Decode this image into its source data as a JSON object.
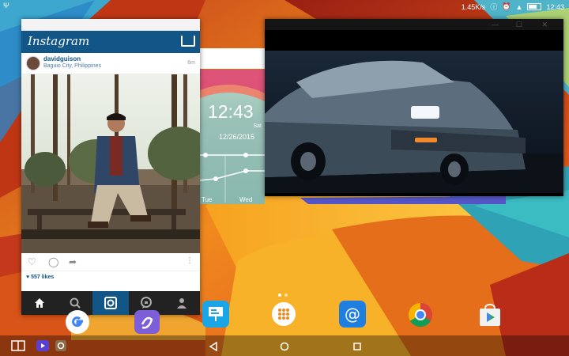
{
  "status_bar": {
    "network_speed": "1.45K/s",
    "clock": "12:43",
    "left_icon": "usb-icon"
  },
  "instagram": {
    "logo": "Instagram",
    "post": {
      "username": "davidguison",
      "location": "Baguio City, Philippines",
      "time": "6m",
      "likes": "♥ 557 likes"
    },
    "nav": [
      "home-icon",
      "search-icon",
      "camera-icon",
      "activity-icon",
      "profile-icon"
    ],
    "colors": {
      "brand": "#125688"
    }
  },
  "clock_widget": {
    "time": "12:43",
    "day": "Sat",
    "date": "12/26/2015",
    "days": [
      "Tue",
      "Wed"
    ]
  },
  "video_window": {
    "controls": [
      "minimize-icon",
      "maximize-icon",
      "close-icon"
    ]
  },
  "dock": {
    "apps": [
      "google-icon",
      "contacts-icon",
      "presentation-icon",
      "app-drawer-icon",
      "email-icon",
      "chrome-icon",
      "play-store-icon"
    ]
  },
  "nav_bar": {
    "left": [
      "multi-window-icon",
      "video-icon",
      "instagram-icon"
    ],
    "center": [
      "back-icon",
      "home-icon",
      "recents-icon"
    ]
  }
}
